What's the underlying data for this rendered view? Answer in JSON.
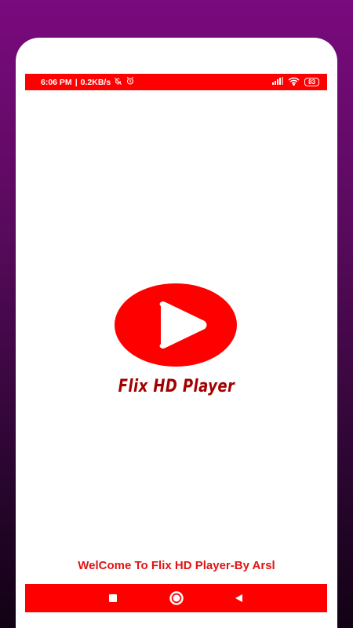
{
  "status_bar": {
    "time": "6:06 PM",
    "separator": "|",
    "speed": "0.2KB/s",
    "battery": "83",
    "icons": [
      "bell-off-icon",
      "alarm-clock-icon",
      "signal-icon",
      "wifi-icon",
      "battery-icon"
    ]
  },
  "splash": {
    "app_title": "Flix HD Player",
    "welcome_text": "WelCome To Flix HD Player-By Arsl",
    "logo_icon": "play-button-logo-icon"
  },
  "nav_bar": {
    "buttons": [
      "recents-square-icon",
      "home-circle-icon",
      "back-triangle-icon"
    ]
  },
  "colors": {
    "accent": "#ff0000",
    "title": "#a30000",
    "welcome": "#e01515",
    "background_top": "#7a0a7e",
    "background_bottom": "#120214"
  }
}
